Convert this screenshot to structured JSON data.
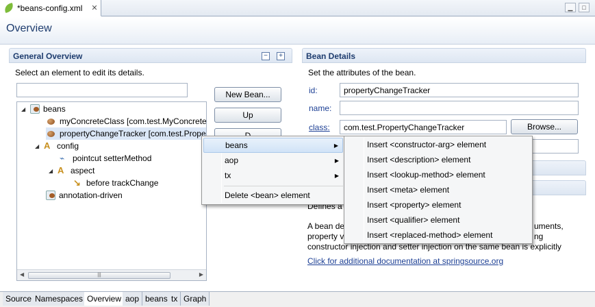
{
  "editor": {
    "tab_title": "*beans-config.xml"
  },
  "page_title": "Overview",
  "general": {
    "title": "General Overview",
    "instruction": "Select an element to edit its details.",
    "filter_value": "",
    "buttons": {
      "new_bean": "New Bean...",
      "up": "Up",
      "down": "D"
    },
    "collapse_glyph": "−",
    "expand_glyph": "+",
    "tree": {
      "beans": "beans",
      "my_concrete": "myConcreteClass [com.test.MyConcrete",
      "property_tracker": "propertyChangeTracker [com.test.Prope",
      "config": "config",
      "pointcut": "pointcut setterMethod",
      "aspect": "aspect",
      "before": "before trackChange",
      "annotation_driven": "annotation-driven"
    }
  },
  "details": {
    "title": "Bean Details",
    "instruction": "Set the attributes of the bean.",
    "id_label": "id:",
    "id_value": "propertyChangeTracker",
    "name_label": "name:",
    "name_value": "",
    "class_label": "class:",
    "class_value": "com.test.PropertyChangeTracker",
    "browse": "Browse...",
    "desc_defines": "Defines a",
    "desc_line1_start": "A bean de",
    "desc_line1_end": "uments,",
    "desc_line2_start": "property v",
    "desc_line2_end": "ng",
    "desc_line3": "constructor injection and setter injection on the same bean is explicitly",
    "doc_link": "Click for additional documentation at springsource.org"
  },
  "context_menu": {
    "items": [
      "beans",
      "aop",
      "tx"
    ],
    "delete": "Delete <bean> element"
  },
  "submenu": {
    "items": [
      "Insert <constructor-arg> element",
      "Insert <description> element",
      "Insert <lookup-method> element",
      "Insert <meta> element",
      "Insert <property> element",
      "Insert <qualifier> element",
      "Insert <replaced-method> element"
    ]
  },
  "bottom_tabs": [
    "Source",
    "Namespaces",
    "Overview",
    "aop",
    "beans",
    "tx",
    "Graph"
  ],
  "colors": {
    "title_blue": "#1e3c6e",
    "menu_highlight": "#d1e3f7",
    "selection": "#dbe7f7"
  }
}
